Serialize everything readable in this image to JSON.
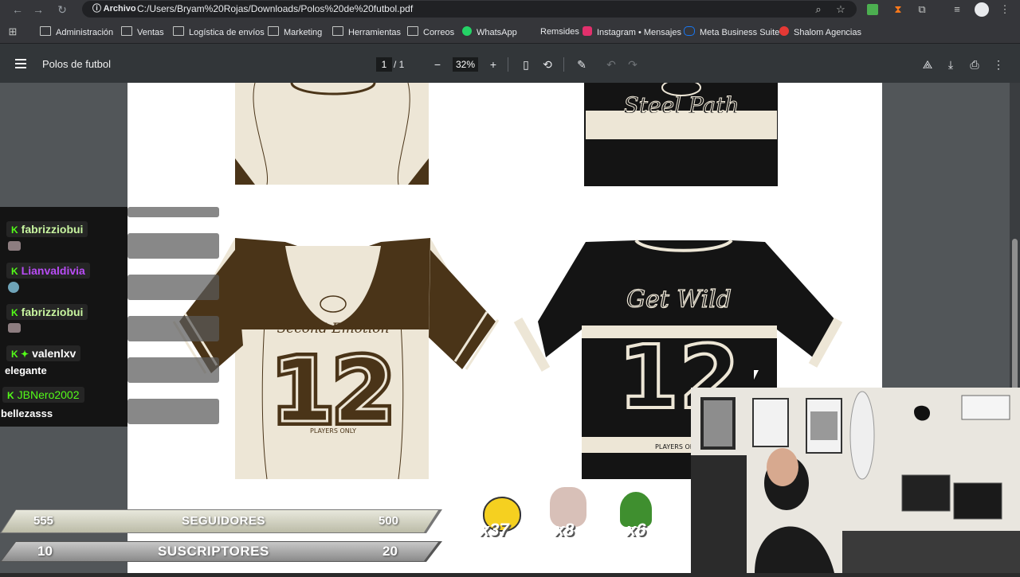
{
  "browser": {
    "url_chip": "Archivo",
    "url": "C:/Users/Bryam%20Rojas/Downloads/Polos%20de%20futbol.pdf",
    "bookmarks": [
      "Administración",
      "Ventas",
      "Logística de envíos",
      "Marketing",
      "Herramientas",
      "Correos",
      "WhatsApp",
      "Remsides",
      "Instagram • Mensajes",
      "Meta Business Suite",
      "Shalom Agencias"
    ]
  },
  "pdf": {
    "title": "Polos de futbol",
    "page_current": "1",
    "page_total": "/ 1",
    "zoom": "32%",
    "jersey_left": {
      "name": "Second Emotion",
      "number": "12",
      "footer": "PLAYERS ONLY"
    },
    "jersey_right": {
      "name": "Get Wild",
      "number": "12",
      "footer": "PLAYERS ON"
    },
    "top_right_text": "Steel Path"
  },
  "chat": [
    {
      "user": "fabrizziobui",
      "color": "#c8f5a0",
      "message": ""
    },
    {
      "user": "Lianvaldivia",
      "color": "#b84cf5",
      "message": ""
    },
    {
      "user": "fabrizziobui",
      "color": "#c8f5a0",
      "message": ""
    },
    {
      "user": "valenlxv",
      "color": "#ffffff",
      "message": "elegante"
    },
    {
      "user": "JBNero2002",
      "color": "#53fc18",
      "message": "bellezasss"
    }
  ],
  "stats": {
    "followers": {
      "current": "555",
      "label": "SEGUIDORES",
      "goal": "500"
    },
    "subscribers": {
      "current": "10",
      "label": "SUSCRIPTORES",
      "goal": "20"
    }
  },
  "emote_counts": [
    "x37",
    "x8",
    "x6"
  ],
  "colors": {
    "brown": "#4a3418",
    "cream": "#ede6d6",
    "black": "#141414"
  }
}
